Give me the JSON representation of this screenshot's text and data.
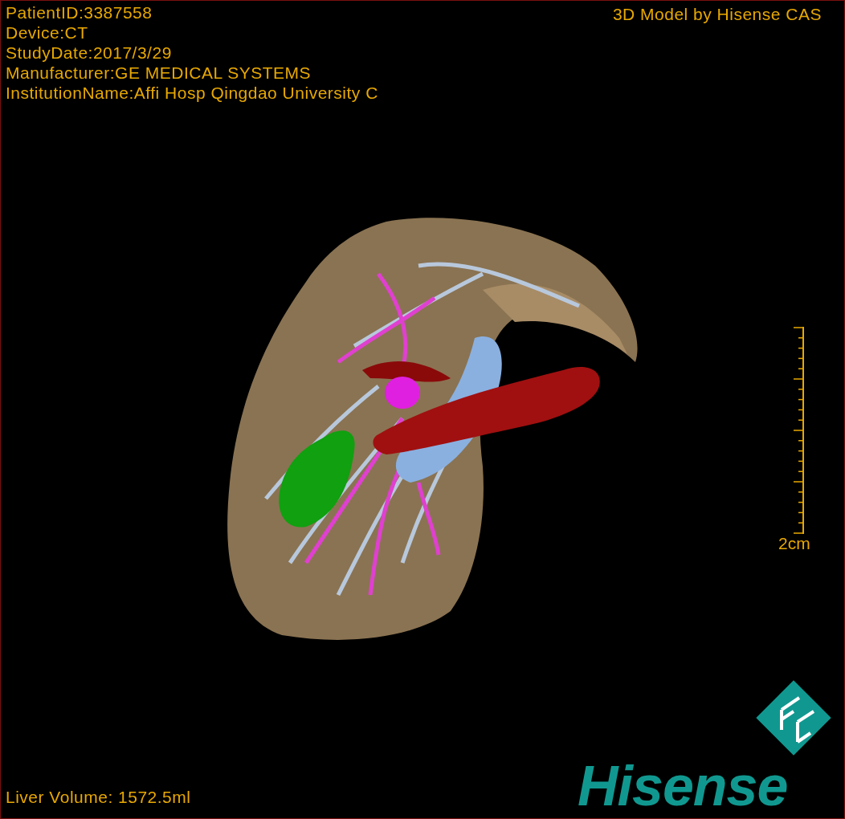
{
  "overlay": {
    "patient_info": [
      "PatientID:3387558",
      "Device:CT",
      "StudyDate:2017/3/29",
      "Manufacturer:GE MEDICAL SYSTEMS",
      "InstitutionName:Affi Hosp Qingdao University C"
    ],
    "model_caption": "3D Model by Hisense CAS",
    "scale_label": "2cm",
    "volume": "Liver Volume: 1572.5ml"
  },
  "logo": {
    "text": "Hisense"
  }
}
